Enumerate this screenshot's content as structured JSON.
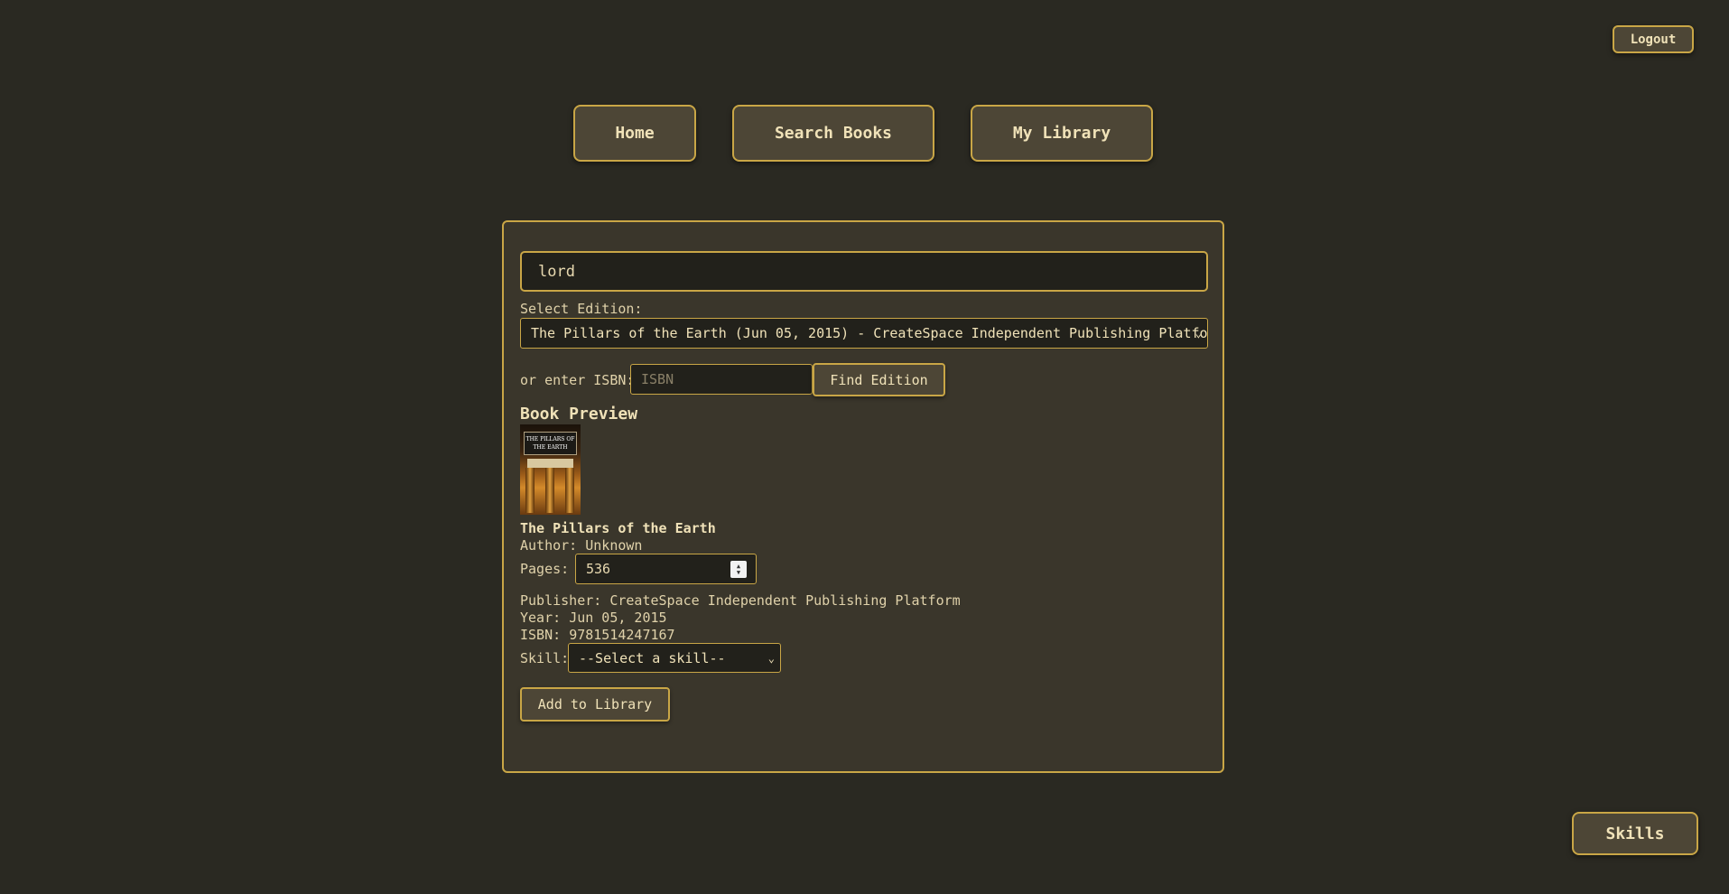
{
  "header": {
    "logout_label": "Logout"
  },
  "nav": {
    "home": "Home",
    "search": "Search Books",
    "library": "My Library"
  },
  "search": {
    "query": "lord",
    "edition_label": "Select Edition:",
    "edition_selected": "The Pillars of the Earth (Jun 05, 2015) - CreateSpace Independent Publishing Platform",
    "isbn_label": "or enter ISBN:",
    "isbn_placeholder": "ISBN",
    "find_label": "Find Edition"
  },
  "preview": {
    "heading": "Book Preview",
    "cover_title": "THE PILLARS OF THE EARTH",
    "title": "The Pillars of the Earth",
    "author_label": "Author:",
    "author": "Unknown",
    "pages_label": "Pages:",
    "pages": "536",
    "publisher_label": "Publisher:",
    "publisher": "CreateSpace Independent Publishing Platform",
    "year_label": "Year:",
    "year": "Jun 05, 2015",
    "isbn_label": "ISBN:",
    "isbn": "9781514247167",
    "skill_label": "Skill:",
    "skill_selected": "--Select a skill--",
    "add_label": "Add to Library"
  },
  "footer": {
    "skills_label": "Skills"
  },
  "colors": {
    "background": "#2a2922",
    "panel": "#3a362b",
    "accent": "#c9a646",
    "button": "#4d4636"
  }
}
